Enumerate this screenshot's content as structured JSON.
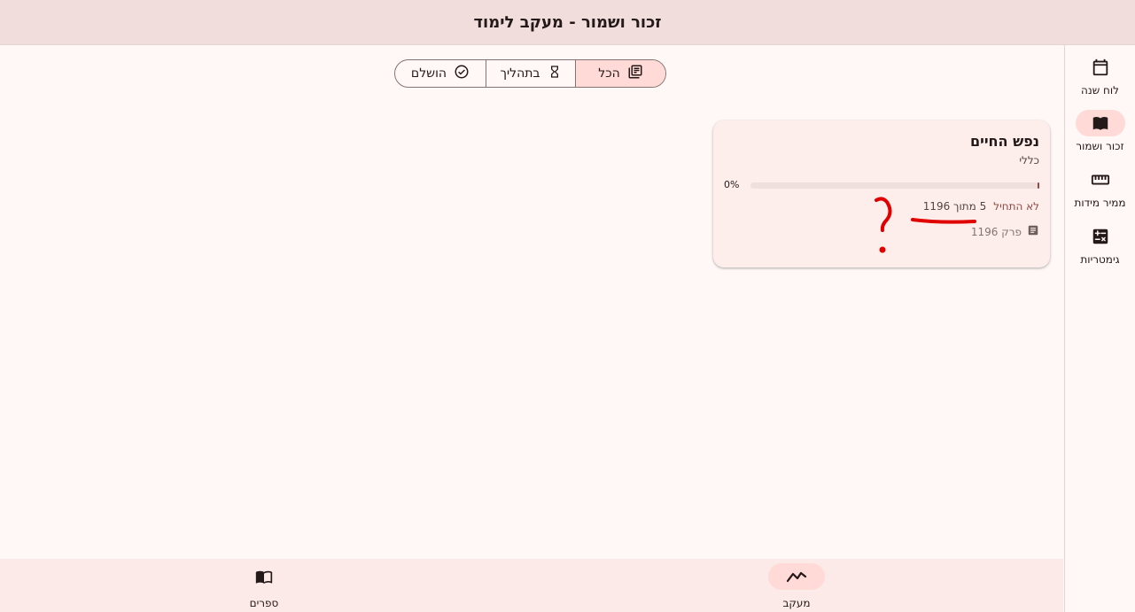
{
  "app": {
    "title": "זכור ושמור - מעקב לימוד"
  },
  "rail": {
    "items": [
      {
        "label": "לוח שנה",
        "icon": "calendar-icon",
        "active": false
      },
      {
        "label": "זכור ושמור",
        "icon": "book-icon",
        "active": true
      },
      {
        "label": "ממיר מידות",
        "icon": "ruler-icon",
        "active": false
      },
      {
        "label": "גימטריות",
        "icon": "calculator-icon",
        "active": false
      }
    ]
  },
  "filters": {
    "selected": "all",
    "items": [
      {
        "id": "all",
        "label": "הכל",
        "icon": "library-books-icon"
      },
      {
        "id": "in_progress",
        "label": "בתהליך",
        "icon": "hourglass-icon"
      },
      {
        "id": "completed",
        "label": "הושלם",
        "icon": "check-circle-icon"
      }
    ]
  },
  "card": {
    "title": "נפש החיים",
    "category": "כללי",
    "progress_label": "0%",
    "progress_fraction": 0.0,
    "count_text": "5 מתוך 1196",
    "status": "לא התחיל",
    "chapters_text": "1196 פרק"
  },
  "bottom_nav": {
    "items": [
      {
        "label": "מעקב",
        "icon": "trending-icon",
        "active": true
      },
      {
        "label": "ספרים",
        "icon": "menu-book-icon",
        "active": false
      }
    ]
  },
  "colors": {
    "primary": "#904a44",
    "selected_bg": "#ffdad6",
    "annotation": "#e00000"
  }
}
